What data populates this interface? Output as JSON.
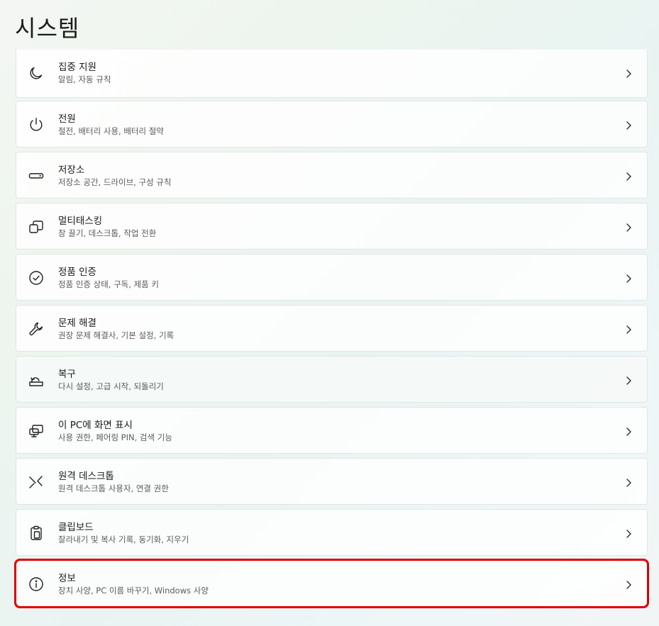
{
  "page": {
    "title": "시스템"
  },
  "items": [
    {
      "id": "focus",
      "icon": "moon-icon",
      "title": "집중 지원",
      "description": "알림, 자동 규칙"
    },
    {
      "id": "power",
      "icon": "power-icon",
      "title": "전원",
      "description": "절전, 배터리 사용, 배터리 절약"
    },
    {
      "id": "storage",
      "icon": "storage-icon",
      "title": "저장소",
      "description": "저장소 공간, 드라이브, 구성 규칙"
    },
    {
      "id": "multitasking",
      "icon": "multitasking-icon",
      "title": "멀티태스킹",
      "description": "창 끌기, 데스크톱, 작업 전환"
    },
    {
      "id": "activation",
      "icon": "checkmark-circle-icon",
      "title": "정품 인증",
      "description": "정품 인증 상태, 구독, 제품 키"
    },
    {
      "id": "troubleshoot",
      "icon": "wrench-icon",
      "title": "문제 해결",
      "description": "권장 문제 해결사, 기본 설정, 기록"
    },
    {
      "id": "recovery",
      "icon": "recovery-icon",
      "title": "복구",
      "description": "다시 설정, 고급 시작, 되돌리기"
    },
    {
      "id": "projecting",
      "icon": "project-to-pc-icon",
      "title": "이 PC에 화면 표시",
      "description": "사용 권한, 페어링 PIN, 검색 기능"
    },
    {
      "id": "remote-desktop",
      "icon": "remote-desktop-icon",
      "title": "원격 데스크톱",
      "description": "원격 데스크톱 사용자, 연결 권한"
    },
    {
      "id": "clipboard",
      "icon": "clipboard-icon",
      "title": "클립보드",
      "description": "잘라내기 및 복사 기록, 동기화, 지우기"
    },
    {
      "id": "about",
      "icon": "info-icon",
      "title": "정보",
      "description": "장치 사양, PC 이름 바꾸기, Windows 사양"
    }
  ],
  "chevron_icon": "chevron-right-icon",
  "highlight_color": "#e00000"
}
